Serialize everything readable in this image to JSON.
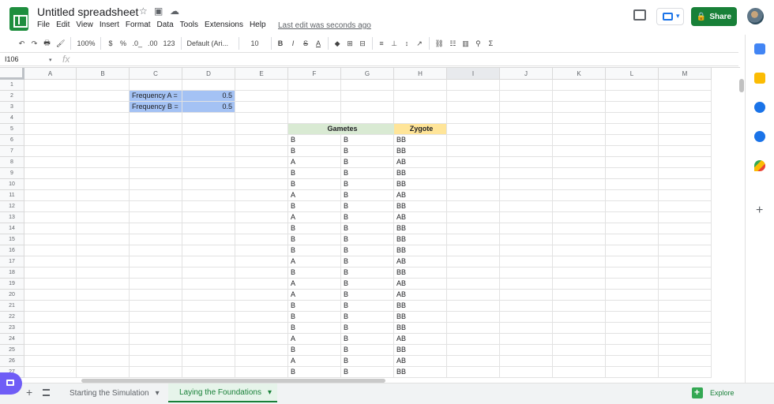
{
  "document": {
    "title": "Untitled spreadsheet",
    "last_edit": "Last edit was seconds ago",
    "menus": [
      "File",
      "Edit",
      "View",
      "Insert",
      "Format",
      "Data",
      "Tools",
      "Extensions",
      "Help"
    ]
  },
  "header": {
    "share_label": "Share",
    "icons": [
      "star-icon",
      "folder-icon",
      "cloud-icon",
      "comment-icon",
      "present-icon",
      "lock-icon",
      "avatar"
    ]
  },
  "toolbar": {
    "undo": "↶",
    "redo": "↷",
    "print": "🖶",
    "paint": "🖌",
    "zoom": "100%",
    "currency": "$",
    "percent": "%",
    "decimal_less": ".0_",
    "decimal_more": ".00",
    "number_format": "123",
    "font": "Default (Ari...",
    "font_size": "10",
    "bold": "B",
    "italic": "I",
    "strike": "S",
    "text_color": "A",
    "fill": "◆",
    "borders": "⊞",
    "merge": "⊟",
    "align": "≡",
    "valign": "⊥",
    "wrap": "↕",
    "rotate": "↗",
    "link": "⛓",
    "comment": "☷",
    "chart": "▥",
    "filter": "⚲",
    "functions": "Σ"
  },
  "formula_bar": {
    "cell_reference": "I106",
    "fx_label": "fx",
    "value": ""
  },
  "columns": [
    "A",
    "B",
    "C",
    "D",
    "E",
    "F",
    "G",
    "H",
    "I",
    "J",
    "K",
    "L",
    "M"
  ],
  "rows": [
    "1",
    "2",
    "3",
    "4",
    "5",
    "6",
    "7",
    "8",
    "9",
    "10",
    "11",
    "12",
    "13",
    "14",
    "15",
    "16",
    "17",
    "18",
    "19",
    "20",
    "21",
    "22",
    "23",
    "24",
    "25",
    "26",
    "27"
  ],
  "cells": {
    "C2": "Frequency A =",
    "D2": "0.5",
    "C3": "Frequency B =",
    "D3": "0.5",
    "F5": "Gametes",
    "H5": "Zygote"
  },
  "gametes": [
    [
      "B",
      "B",
      "BB"
    ],
    [
      "B",
      "B",
      "BB"
    ],
    [
      "A",
      "B",
      "AB"
    ],
    [
      "B",
      "B",
      "BB"
    ],
    [
      "B",
      "B",
      "BB"
    ],
    [
      "A",
      "B",
      "AB"
    ],
    [
      "B",
      "B",
      "BB"
    ],
    [
      "A",
      "B",
      "AB"
    ],
    [
      "B",
      "B",
      "BB"
    ],
    [
      "B",
      "B",
      "BB"
    ],
    [
      "B",
      "B",
      "BB"
    ],
    [
      "A",
      "B",
      "AB"
    ],
    [
      "B",
      "B",
      "BB"
    ],
    [
      "A",
      "B",
      "AB"
    ],
    [
      "A",
      "B",
      "AB"
    ],
    [
      "B",
      "B",
      "BB"
    ],
    [
      "B",
      "B",
      "BB"
    ],
    [
      "B",
      "B",
      "BB"
    ],
    [
      "A",
      "B",
      "AB"
    ],
    [
      "B",
      "B",
      "BB"
    ],
    [
      "A",
      "B",
      "AB"
    ],
    [
      "B",
      "B",
      "BB"
    ]
  ],
  "sheets": {
    "inactive": "Starting the Simulation",
    "active": "Laying the Foundations",
    "explore": "Explore"
  },
  "colors": {
    "green": "#188038",
    "blue_fill": "#a4c2f4",
    "header_green": "#d9ead3",
    "header_yellow": "#ffe599"
  }
}
